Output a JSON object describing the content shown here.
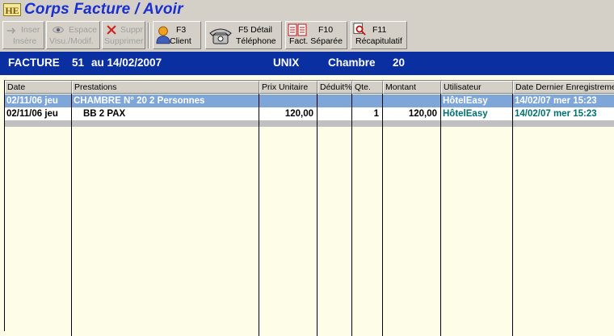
{
  "window": {
    "logo": "HE",
    "title": "Corps Facture / Avoir"
  },
  "toolbar": {
    "insert": {
      "line1": "Inser",
      "line2": "Insère",
      "icon": "insert-icon"
    },
    "space": {
      "line1": "Espace",
      "line2": "Visu./Modif.",
      "icon": "eye-icon"
    },
    "delete": {
      "line1": "Suppr",
      "line2": "Supprimer",
      "icon": "delete-x-icon"
    },
    "client": {
      "line1": "F3",
      "line2": "Client",
      "icon": "person-icon"
    },
    "phone": {
      "line1": "F5 Détail",
      "line2": "Téléphone",
      "icon": "telephone-icon"
    },
    "separate": {
      "line1": "F10",
      "line2": "Fact. Séparée",
      "icon": "invoice-split-icon"
    },
    "summary": {
      "line1": "F11",
      "line2": "Récapitulatif",
      "icon": "magnifier-icon"
    }
  },
  "header": {
    "facture_label": "FACTURE",
    "facture_no": "51",
    "date_text": "au 14/02/2007",
    "client": "UNIX",
    "chambre_label": "Chambre",
    "chambre_no": "20"
  },
  "grid": {
    "columns": [
      "Date",
      "Prestations",
      "Prix Unitaire",
      "Déduit%",
      "Qte.",
      "Montant",
      "Utilisateur",
      "Date Dernier Enregistrement"
    ],
    "rows": [
      {
        "date": "02/11/06 jeu",
        "prestation": "CHAMBRE N° 20 2 Personnes",
        "prix": "",
        "deduit": "",
        "qte": "",
        "montant": "",
        "user": "HôtelEasy",
        "last": "14/02/07 mer 15:23"
      },
      {
        "date": "02/11/06 jeu",
        "prestation": "BB 2 PAX",
        "prix": "120,00",
        "deduit": "",
        "qte": "1",
        "montant": "120,00",
        "user": "HôtelEasy",
        "last": "14/02/07 mer 15:23"
      }
    ]
  },
  "colors": {
    "title": "#1a2fd0",
    "header_band": "#0a2fa0",
    "selected_row": "#7fa6d8",
    "user_text": "#007070",
    "grid_bg": "#fefee8"
  }
}
